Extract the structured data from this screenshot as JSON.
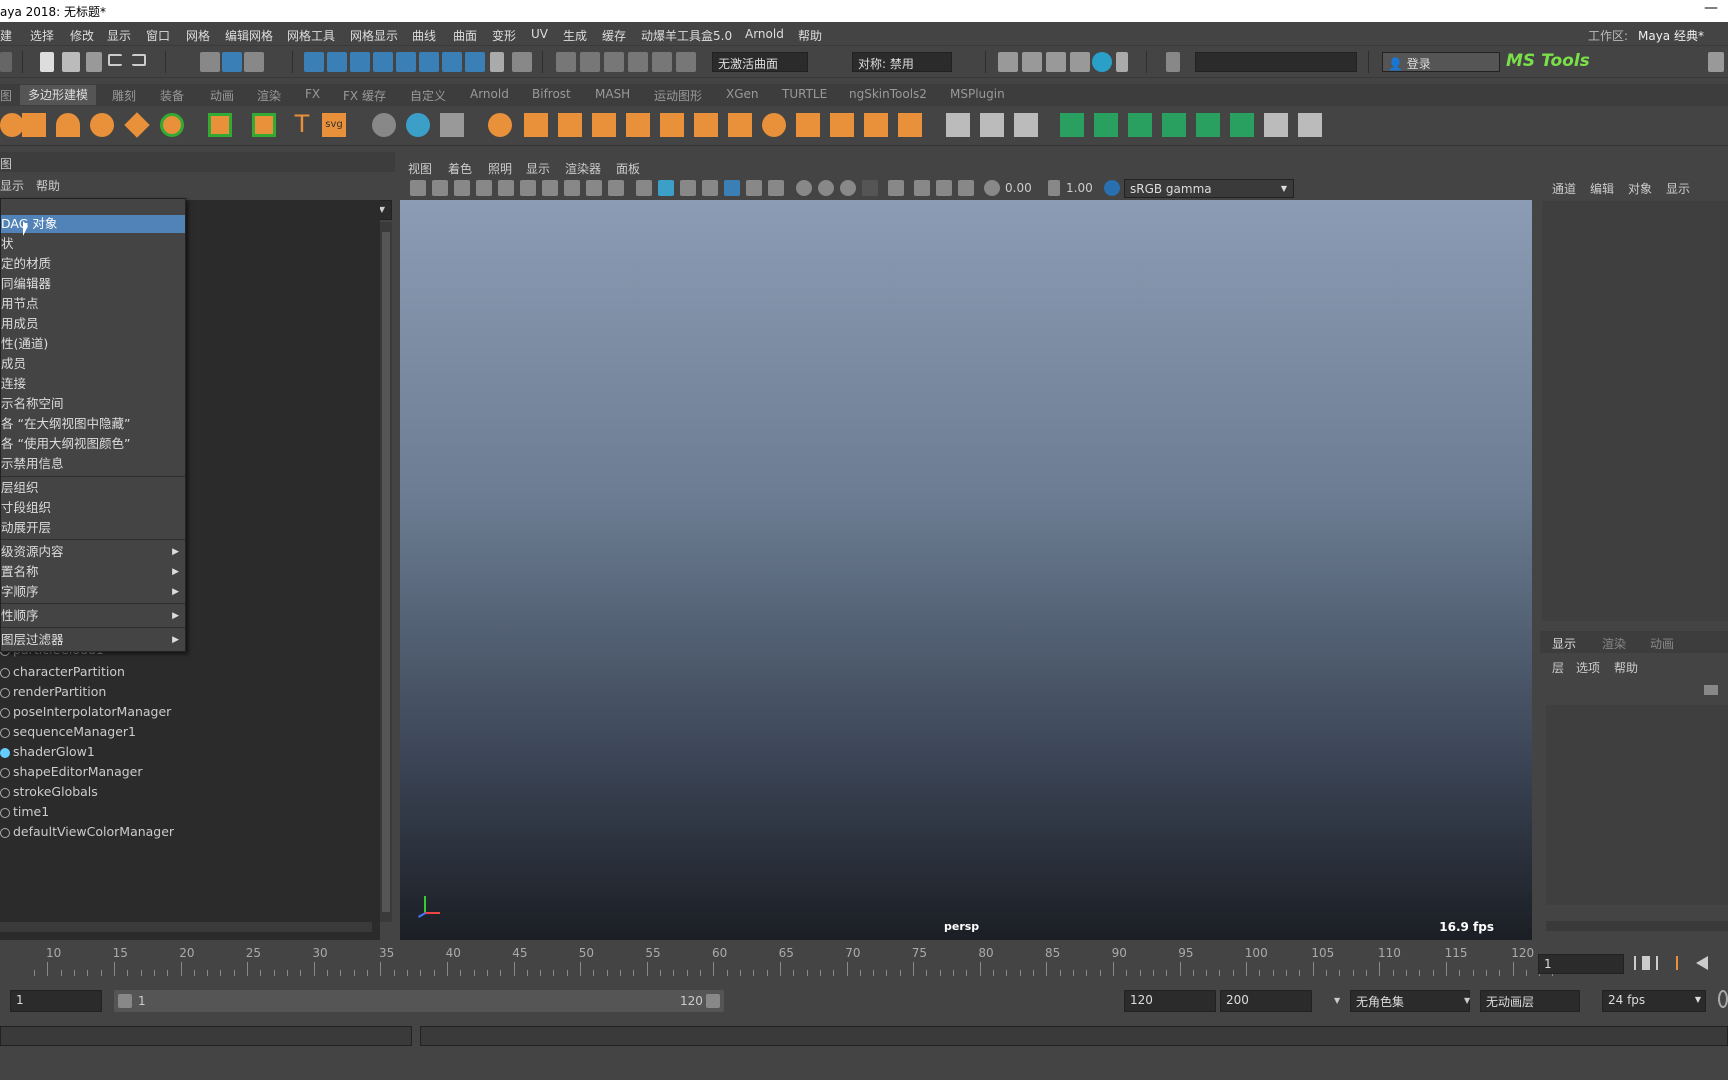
{
  "titlebar": {
    "title": "aya 2018: 无标题*",
    "minimize": "—"
  },
  "menubar": {
    "items": [
      "建",
      "选择",
      "修改",
      "显示",
      "窗口",
      "网格",
      "编辑网格",
      "网格工具",
      "网格显示",
      "曲线",
      "曲面",
      "变形",
      "UV",
      "生成",
      "缓存",
      "动爆羊工具盒5.0",
      "Arnold",
      "帮助"
    ],
    "workspace_label": "工作区:",
    "workspace_value": "Maya 经典*"
  },
  "statusline": {
    "no_live_surface": "无激活曲面",
    "symmetry": "对称: 禁用",
    "login": "登录",
    "ms_tools": "MS Tools"
  },
  "shelf": {
    "tabs": [
      "图",
      "多边形建模",
      "雕刻",
      "装备",
      "动画",
      "渲染",
      "FX",
      "FX 缓存",
      "自定义",
      "Arnold",
      "Bifrost",
      "MASH",
      "运动图形",
      "XGen",
      "TURTLE",
      "ngSkinTools2",
      "MSPlugin"
    ],
    "active_tab": 1
  },
  "outliner": {
    "header": "图",
    "menu": [
      "显示",
      "帮助"
    ],
    "items": [
      "particleCloud1",
      "characterPartition",
      "renderPartition",
      "poseInterpolatorManager",
      "sequenceManager1",
      "shaderGlow1",
      "shapeEditorManager",
      "strokeGlobals",
      "time1",
      "defaultViewColorManager"
    ]
  },
  "context_menu": {
    "items": [
      {
        "label": "DAG 对象",
        "highlighted": true
      },
      {
        "label": "状"
      },
      {
        "label": "定的材质"
      },
      {
        "label": "同编辑器"
      },
      {
        "label": "用节点"
      },
      {
        "label": "用成员"
      },
      {
        "label": "性(通道)"
      },
      {
        "label": "成员"
      },
      {
        "label": "连接"
      },
      {
        "label": "示名称空间"
      },
      {
        "label": "各 “在大纲视图中隐藏”"
      },
      {
        "label": "各 “使用大纲视图颜色”"
      },
      {
        "label": "示禁用信息"
      },
      {
        "label": "层组织",
        "divider_before": true
      },
      {
        "label": "寸段组织"
      },
      {
        "label": "动展开层"
      },
      {
        "label": "级资源内容",
        "divider_before": true,
        "submenu": true
      },
      {
        "label": "置名称",
        "submenu": true
      },
      {
        "label": "字顺序",
        "submenu": true
      },
      {
        "label": "性顺序",
        "divider_before": true,
        "submenu": true
      },
      {
        "label": "图层过滤器",
        "divider_before": true,
        "submenu": true
      }
    ]
  },
  "viewport": {
    "menu": [
      "视图",
      "着色",
      "照明",
      "显示",
      "渲染器",
      "面板"
    ],
    "exposure": "0.00",
    "gamma": "1.00",
    "color_space": "sRGB gamma",
    "camera": "persp",
    "fps": "16.9 fps"
  },
  "channelbox": {
    "menu": [
      "通道",
      "编辑",
      "对象",
      "显示"
    ],
    "layer_tabs": [
      "显示",
      "渲染",
      "动画"
    ],
    "layer_menu": [
      "层",
      "选项",
      "帮助"
    ]
  },
  "timeline": {
    "ticks": [
      "10",
      "15",
      "20",
      "25",
      "30",
      "35",
      "40",
      "45",
      "50",
      "55",
      "60",
      "65",
      "70",
      "75",
      "80",
      "85",
      "90",
      "95",
      "100",
      "105",
      "110",
      "115",
      "120"
    ],
    "current_frame": "1"
  },
  "range": {
    "start": "1",
    "slider_start": "1",
    "slider_end": "120",
    "end": "120",
    "anim_end": "200",
    "character_set": "无角色集",
    "anim_layer": "无动画层",
    "fps": "24 fps"
  },
  "colors": {
    "accent": "#5283b8",
    "tool_blue": "#3b7fb7",
    "ms_green": "#7ae04a"
  }
}
